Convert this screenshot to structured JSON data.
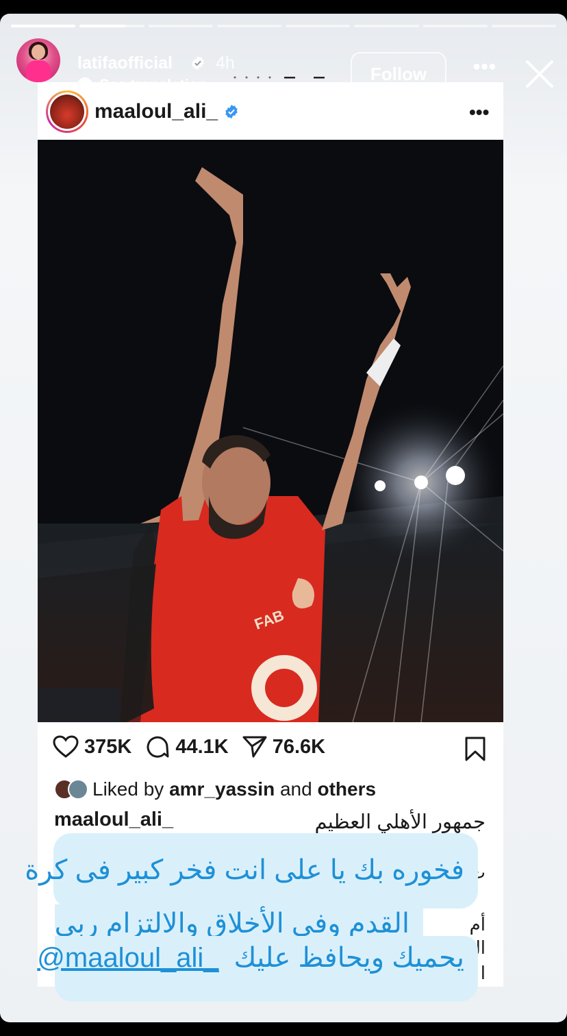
{
  "story": {
    "progress": {
      "segments": 8,
      "current": 2,
      "current_fill": 0.7
    },
    "header": {
      "username": "latifaofficial",
      "time": "4h",
      "translate": "See translation",
      "follow": "Follow"
    }
  },
  "post": {
    "username": "maaloul_ali_",
    "stats": {
      "likes": "375K",
      "comments": "44.1K",
      "shares": "76.6K"
    },
    "liked_by": {
      "prefix": "Liked by",
      "user": "amr_yassin",
      "and": "and",
      "others": "others"
    },
    "caption_user": "maaloul_ali_",
    "caption_text": "جمهور الأهلي العظيم",
    "caption_fragments": [
      "ت",
      "أم",
      "ال",
      "ا"
    ]
  },
  "overlay": {
    "line1": "فخوره بك يا على انت فخر كبير فى كرة",
    "line2": "القدم وفى الأخلاق والالتزام ربى",
    "line3": "يحميك ويحافظ عليك",
    "mention": "@maaloul_ali_",
    "text_color": "#1e90d6",
    "bg_color": "#d9f0fb"
  },
  "colors": {
    "accent_red": "#d92a1f",
    "verified": "#3897f0"
  }
}
